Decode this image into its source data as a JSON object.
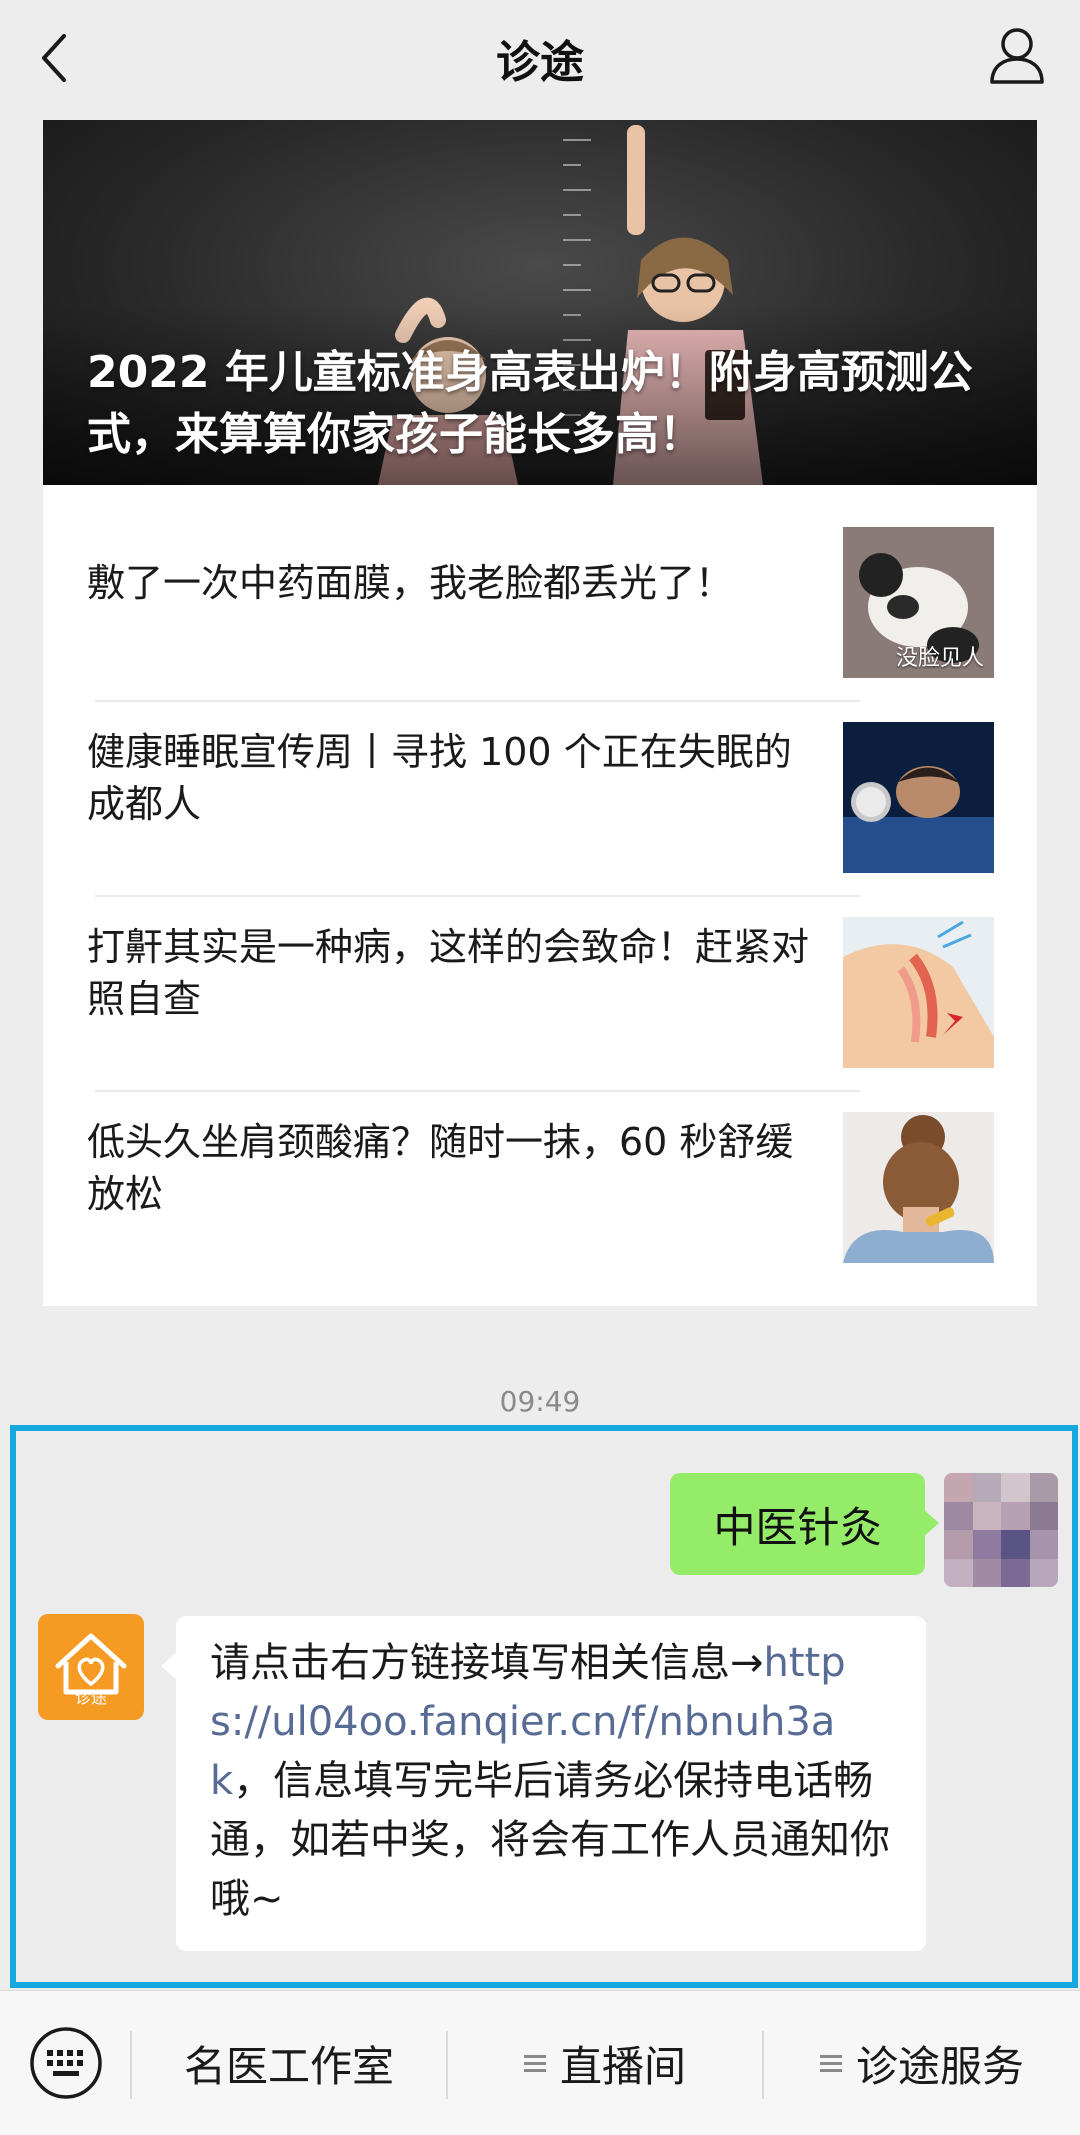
{
  "header": {
    "title": "诊途",
    "back_icon": "chevron-left-icon",
    "profile_icon": "person-icon"
  },
  "feature_article": {
    "title": "2022 年儿童标准身高表出炉！附身高预测公式，来算算你家孩子能长多高！"
  },
  "articles": [
    {
      "title": "敷了一次中药面膜，我老脸都丢光了！",
      "thumb_label": "没脸见人"
    },
    {
      "title": "健康睡眠宣传周丨寻找 100 个正在失眠的成都人"
    },
    {
      "title": "打鼾其实是一种病，这样的会致命！赶紧对照自查"
    },
    {
      "title": "低头久坐肩颈酸痛？随时一抹，60 秒舒缓放松"
    }
  ],
  "chat": {
    "timestamp": "09:49",
    "sent_message": "中医针灸",
    "bot_avatar_label": "诊途",
    "reply": {
      "before_link": "请点击右方链接填写相关信息→",
      "link": "https://ul04oo.fanqier.cn/f/nbnuh3ak",
      "after_link": "，信息填写完毕后请务必保持电话畅通，如若中奖，将会有工作人员通知你哦~"
    }
  },
  "bottom_menu": {
    "keyboard_icon": "keyboard-icon",
    "items": [
      {
        "label": "名医工作室",
        "has_submenu": false
      },
      {
        "label": "直播间",
        "has_submenu": true
      },
      {
        "label": "诊途服务",
        "has_submenu": true
      }
    ]
  },
  "colors": {
    "background": "#ededed",
    "sent_bubble": "#95ec69",
    "link": "#576b95",
    "highlight_border": "#17a8e0",
    "bot_avatar": "#f59a23"
  }
}
